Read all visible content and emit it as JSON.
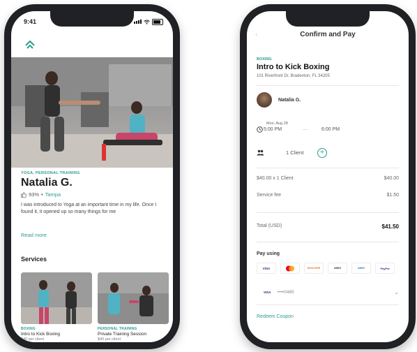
{
  "left_screen": {
    "status_time": "9:41",
    "coach": {
      "category": "YOGA, PERSONAL TRAINING",
      "name": "Natalia G.",
      "rating": "93%",
      "location": "Tampa",
      "bio": "I was introduced to Yoga at an important time in my life. Once I found it, it opened up so many things for me",
      "read_more": "Read more"
    },
    "services_title": "Services",
    "services": [
      {
        "category": "BOXING",
        "title": "Intro to Kick Boxing",
        "price": "$40 per client"
      },
      {
        "category": "PERSONAL TRAINING",
        "title": "Private Training Session",
        "price": "$40 per client"
      }
    ]
  },
  "right_screen": {
    "header_title": "Confirm and Pay",
    "class_category": "BOXING",
    "class_title": "Intro to Kick Boxing",
    "address": "101 Riverfront Dr, Bradenton, FL 34205",
    "coach_name": "Natalia G.",
    "date": "Mon, Aug 28",
    "start_time": "5:00 PM",
    "end_time": "6:00 PM",
    "clients": "1 Client",
    "line_items": [
      {
        "label": "$40.00 x 1 Client",
        "value": "$40.00"
      },
      {
        "label": "Service fee",
        "value": "$1.50"
      }
    ],
    "total_label": "Total (USD)",
    "total_value": "$41.50",
    "pay_using": "Pay using",
    "payment_methods": [
      "VISA",
      "mastercard",
      "DISCOVER",
      "AMEX",
      "AMEX",
      "PayPal"
    ],
    "saved_card_brand": "VISA",
    "saved_card_number": "••••0485",
    "redeem_coupon": "Redeem Coupon"
  },
  "colors": {
    "accent": "#2a9d8f",
    "phone_frame": "#202124"
  }
}
